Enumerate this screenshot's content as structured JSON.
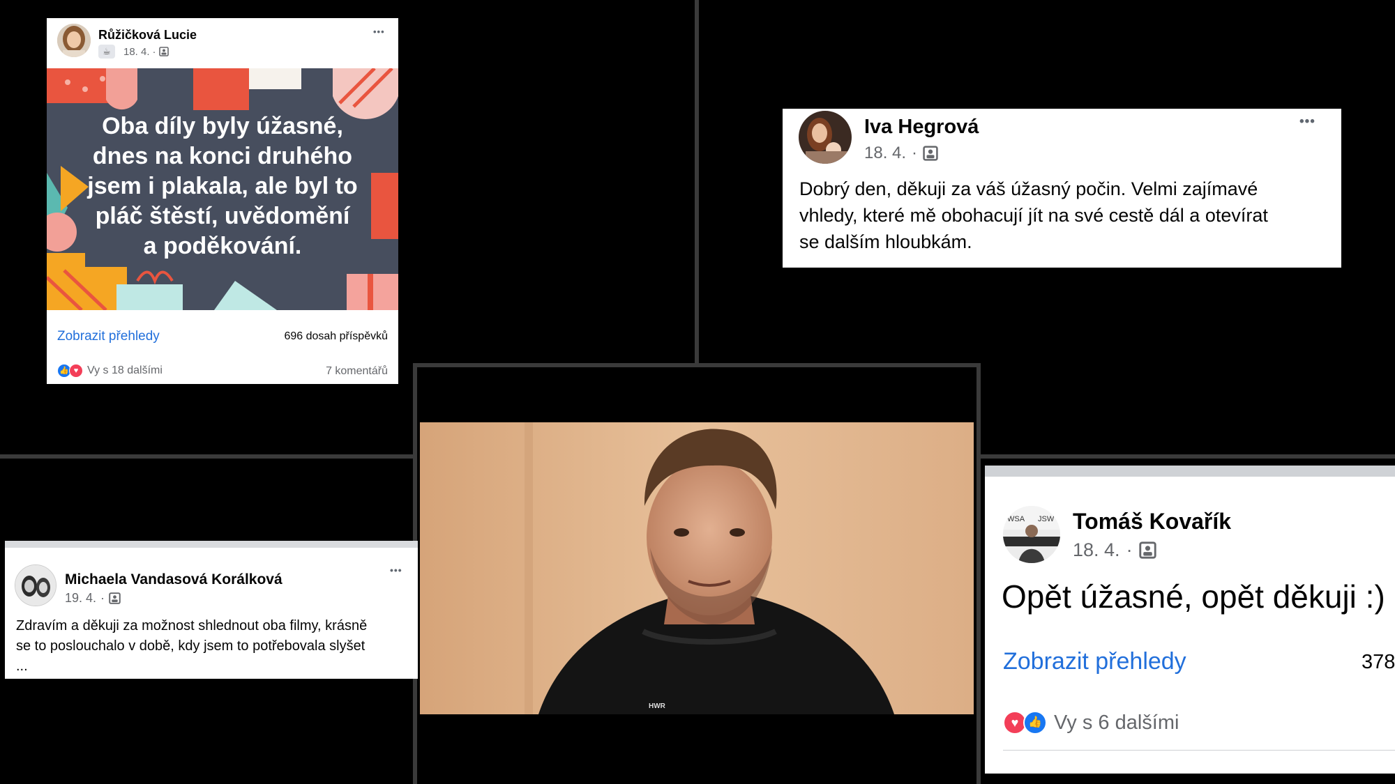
{
  "post1": {
    "author": "Růžičková Lucie",
    "date": "18. 4.",
    "sep": "·",
    "image_text": "Oba díly byly úžasné,\ndnes na konci druhého\njsem i plakala, ale byl to\npláč štěstí, uvědomění\na poděkování.",
    "insights_link": "Zobrazit přehledy",
    "reach": "696 dosah příspěvků",
    "reactions": "Vy s 18 dalšími",
    "comments": "7 komentářů",
    "more": "•••"
  },
  "post2": {
    "author": "Iva Hegrová",
    "date": "18. 4.",
    "sep": "·",
    "text": "Dobrý den, děkuji za váš úžasný počin. Velmi zajímavé\nvhledy, které mě obohacují jít na své cestě dál a otevírat\nse dalším hloubkám.",
    "more": "•••"
  },
  "post3": {
    "author": "Michaela Vandasová Korálková",
    "date": "19. 4.",
    "sep": "·",
    "text": "Zdravím a děkuji za možnost shlednout oba filmy, krásně\nse to poslouchalo v době, kdy jsem to potřebovala slyšet\n...",
    "more": "•••"
  },
  "post4": {
    "author": "Tomáš Kovařík",
    "date": "18. 4.",
    "sep": "·",
    "text": "Opět úžasné, opět děkuji :)",
    "insights_link": "Zobrazit přehledy",
    "reach": "378",
    "reactions": "Vy s 6 dalšími"
  },
  "video": {
    "logo_text": "HWR"
  },
  "colors": {
    "background": "#000000",
    "link": "#216fdb",
    "meta": "#65676b",
    "like": "#1877f2",
    "love": "#f33e58",
    "poster_bg": "#474e5e"
  }
}
